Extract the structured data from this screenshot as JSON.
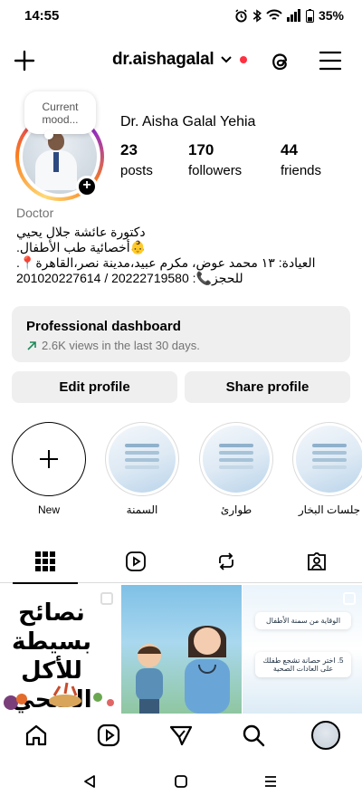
{
  "status_bar": {
    "time": "14:55",
    "battery": "35%",
    "icons": [
      "alarm-icon",
      "bluetooth-icon",
      "wifi-icon",
      "signal-icon",
      "battery-icon"
    ]
  },
  "top_bar": {
    "username": "dr.aishagalal",
    "icons": [
      "plus-icon",
      "chevron-down-icon",
      "threads-icon",
      "menu-icon"
    ],
    "notification_color": "#ff3040"
  },
  "profile": {
    "note_bubble": "Current mood...",
    "full_name": "Dr. Aisha Galal Yehia",
    "stats": [
      {
        "value": "23",
        "label": "posts"
      },
      {
        "value": "170",
        "label": "followers"
      },
      {
        "value": "44",
        "label": "friends"
      }
    ],
    "category": "Doctor",
    "bio_lines": [
      "دكتورة عائشة جلال يحيي",
      "👶أخصائية طب الأطفال.",
      "العيادة: ١٣ محمد عوض، مكرم عبيد،مدينة نصر،القاهرة📍.",
      "للحجز📞: 20222719580 / 201020227614"
    ]
  },
  "dashboard": {
    "title": "Professional dashboard",
    "subtitle": "2.6K views in the last 30 days.",
    "trend_color": "#1d8a5a"
  },
  "actions": {
    "edit": "Edit profile",
    "share": "Share profile"
  },
  "highlights": [
    {
      "label": "New"
    },
    {
      "label": "السمنة"
    },
    {
      "label": "طوارئ"
    },
    {
      "label": "جلسات البخار"
    }
  ],
  "tabs": [
    "grid-icon",
    "reels-icon",
    "reposts-icon",
    "tagged-icon"
  ],
  "grid_posts": {
    "post1_text": "نصائح بسيطة للأكل الصحي",
    "post3_card1": "الوقاية من سمنة الأطفال",
    "post3_card2": "5. اختر حصانة تشجع طفلك على العادات الصحية"
  },
  "bottom_nav": [
    "home-icon",
    "reels-icon",
    "direct-icon",
    "search-icon",
    "profile-avatar"
  ],
  "system_nav": [
    "back-icon",
    "home-button-icon",
    "recents-icon"
  ]
}
